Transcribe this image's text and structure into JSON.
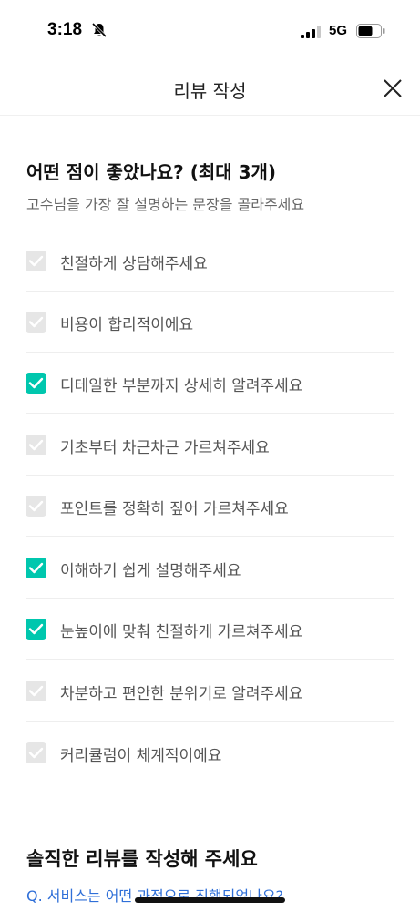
{
  "status": {
    "time": "3:18",
    "network": "5G",
    "bell_icon": "bell-slash-icon",
    "signal_icon": "cellular-signal-icon",
    "battery_icon": "battery-icon"
  },
  "header": {
    "title": "리뷰 작성",
    "close_icon": "close-icon"
  },
  "question": {
    "title": "어떤 점이 좋았나요? (최대 3개)",
    "subtitle": "고수님을 가장 잘 설명하는 문장을 골라주세요"
  },
  "options": [
    {
      "label": "친절하게 상담해주세요",
      "checked": false
    },
    {
      "label": "비용이 합리적이에요",
      "checked": false
    },
    {
      "label": "디테일한 부분까지 상세히 알려주세요",
      "checked": true
    },
    {
      "label": "기초부터 차근차근 가르쳐주세요",
      "checked": false
    },
    {
      "label": "포인트를 정확히 짚어 가르쳐주세요",
      "checked": false
    },
    {
      "label": "이해하기 쉽게 설명해주세요",
      "checked": true
    },
    {
      "label": "눈높이에 맞춰 친절하게 가르쳐주세요",
      "checked": true
    },
    {
      "label": "차분하고 편안한 분위기로 알려주세요",
      "checked": false
    },
    {
      "label": "커리큘럼이 체계적이에요",
      "checked": false
    }
  ],
  "review": {
    "title": "솔직한 리뷰를 작성해 주세요",
    "question": "Q. 서비스는 어떤 과정으로 진행되었나요?"
  },
  "colors": {
    "accent": "#00c7ae",
    "unchecked": "#e6e6e6",
    "link": "#2f6fd8"
  }
}
